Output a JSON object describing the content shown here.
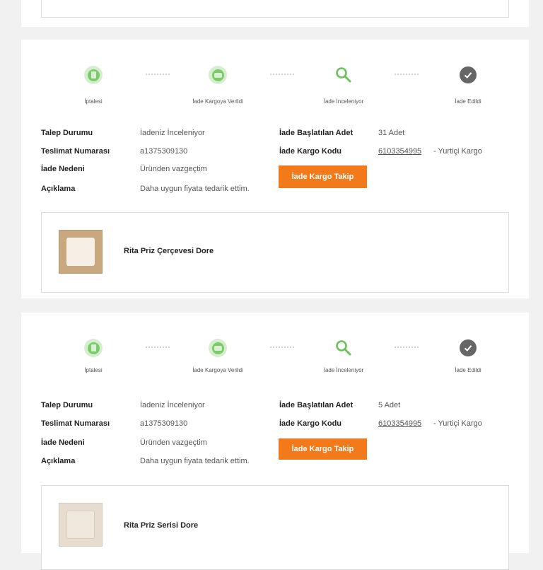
{
  "steps": [
    {
      "label": "İptalesi",
      "icon": "document-icon"
    },
    {
      "label": "İade Kargoya Verildi",
      "icon": "truck-icon"
    },
    {
      "label": "İade İnceleniyor",
      "icon": "magnifier-icon"
    },
    {
      "label": "İade Edildi",
      "icon": "check-icon"
    }
  ],
  "colors": {
    "accent": "#f27a1a",
    "step_green": "#7ccb6b",
    "step_done": "#666666"
  },
  "returns": [
    {
      "labels": {
        "status": "Talep Durumu",
        "delivery_no": "Teslimat Numarası",
        "reason": "İade Nedeni",
        "description": "Açıklama",
        "qty": "İade Başlatılan Adet",
        "cargo_code": "İade Kargo Kodu"
      },
      "status": "İadeniz İnceleniyor",
      "delivery_no": "a1375309130",
      "reason": "Üründen vazgeçtim",
      "description": "Daha uygun fiyata tedarik ettim.",
      "qty": "31 Adet",
      "cargo_code": "6103354995",
      "carrier": "- Yurtiçi Kargo",
      "button": "İade Kargo Takip",
      "product_name": "Rita Priz Çerçevesi Dore"
    },
    {
      "labels": {
        "status": "Talep Durumu",
        "delivery_no": "Teslimat Numarası",
        "reason": "İade Nedeni",
        "description": "Açıklama",
        "qty": "İade Başlatılan Adet",
        "cargo_code": "İade Kargo Kodu"
      },
      "status": "İadeniz İnceleniyor",
      "delivery_no": "a1375309130",
      "reason": "Üründen vazgeçtim",
      "description": "Daha uygun fiyata tedarik ettim.",
      "qty": "5 Adet",
      "cargo_code": "6103354995",
      "carrier": "- Yurtiçi Kargo",
      "button": "İade Kargo Takip",
      "product_name": "Rita Priz Serisi Dore"
    }
  ]
}
